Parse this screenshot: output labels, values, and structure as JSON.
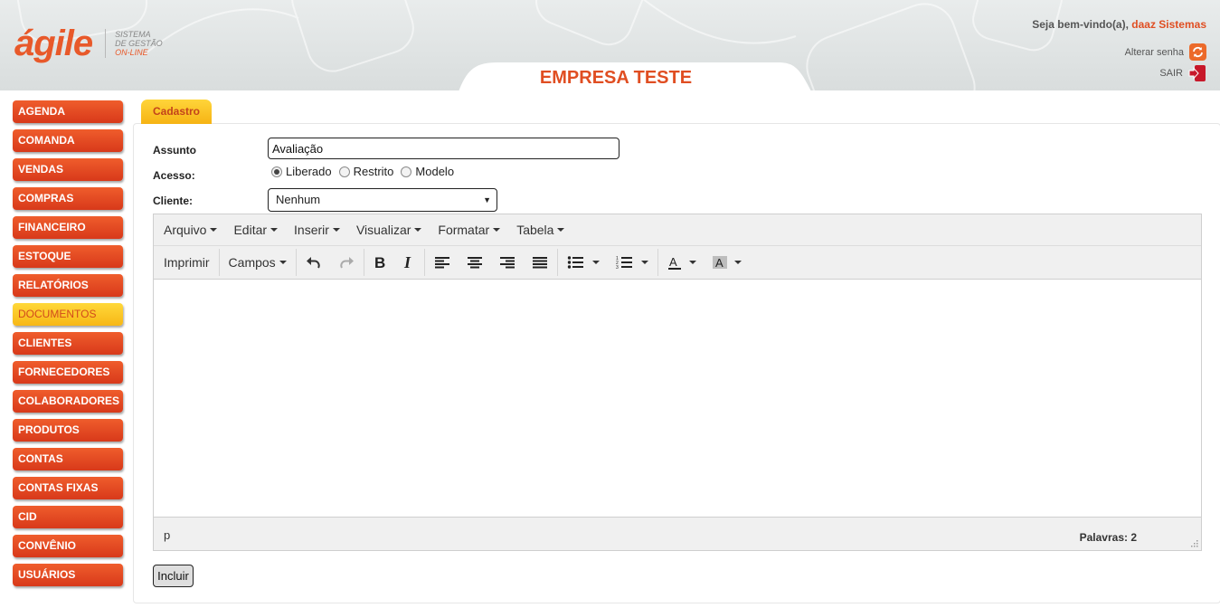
{
  "header": {
    "logo_word": "ágile",
    "logo_tagline": [
      "SISTEMA",
      "DE GESTÃO",
      "ON-LINE"
    ],
    "company": "EMPRESA TESTE",
    "welcome_text": "Seja bem-vindo(a),",
    "user_name": "daaz Sistemas",
    "change_password": "Alterar senha",
    "logout": "SAIR",
    "colors": {
      "brand": "#e8592a",
      "nav": "#e2421f",
      "active": "#fbc524"
    }
  },
  "sidebar": {
    "items": [
      {
        "label": "AGENDA"
      },
      {
        "label": "COMANDA"
      },
      {
        "label": "VENDAS"
      },
      {
        "label": "COMPRAS"
      },
      {
        "label": "FINANCEIRO"
      },
      {
        "label": "ESTOQUE"
      },
      {
        "label": "RELATÓRIOS"
      },
      {
        "label": "DOCUMENTOS",
        "active": true
      },
      {
        "label": "CLIENTES"
      },
      {
        "label": "FORNECEDORES"
      },
      {
        "label": "COLABORADORES"
      },
      {
        "label": "PRODUTOS"
      },
      {
        "label": "CONTAS"
      },
      {
        "label": "CONTAS FIXAS"
      },
      {
        "label": "CID"
      },
      {
        "label": "CONVÊNIO"
      },
      {
        "label": "USUÁRIOS"
      }
    ]
  },
  "form": {
    "tab_label": "Cadastro",
    "subject_label": "Assunto",
    "subject_value": "Avaliação",
    "access_label": "Acesso:",
    "access_options": [
      {
        "label": "Liberado",
        "selected": true
      },
      {
        "label": "Restrito",
        "selected": false
      },
      {
        "label": "Modelo",
        "selected": false
      }
    ],
    "client_label": "Cliente:",
    "client_value": "Nenhum",
    "submit_label": "Incluir"
  },
  "editor": {
    "menus": [
      "Arquivo",
      "Editar",
      "Inserir",
      "Visualizar",
      "Formatar",
      "Tabela"
    ],
    "toolbar": {
      "print": "Imprimir",
      "fields": "Campos",
      "icons": [
        "undo-icon",
        "redo-icon",
        "bold-icon",
        "italic-icon",
        "align-left-icon",
        "align-center-icon",
        "align-right-icon",
        "align-justify-icon",
        "bullet-list-icon",
        "numbered-list-icon",
        "text-color-icon",
        "background-color-icon"
      ]
    },
    "status_path": "p",
    "word_count": "Palavras: 2"
  }
}
